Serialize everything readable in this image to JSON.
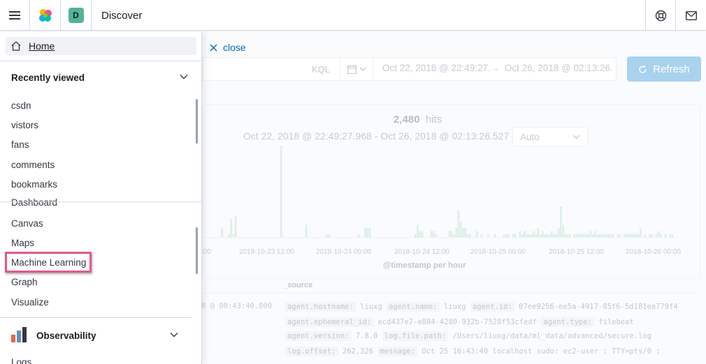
{
  "header": {
    "app_title": "Discover",
    "space_initial": "D",
    "icons": [
      "hamburger-menu-icon",
      "elastic-logo-icon",
      "help-icon",
      "mail-icon"
    ]
  },
  "nav": {
    "home_label": "Home",
    "recently_viewed_title": "Recently viewed",
    "recently_viewed": [
      "csdn",
      "vistors",
      "fans",
      "comments",
      "bookmarks"
    ],
    "kibana_links": [
      "Dashboard",
      "Canvas",
      "Maps",
      "Machine Learning",
      "Graph",
      "Visualize"
    ],
    "highlighted_item": "Machine Learning",
    "observability_title": "Observability",
    "observability_links": [
      "Logs"
    ]
  },
  "discover": {
    "close_label": "close",
    "query_language": "KQL",
    "date_from": "Oct 22, 2018 @ 22:49:27.",
    "date_to": "Oct 26, 2018 @ 02:13:26.",
    "refresh_label": "Refresh",
    "hits_count": "2,480",
    "hits_label": "hits",
    "range_text": "Oct 22, 2018 @ 22:49:27.968 - Oct 26, 2018 @ 02:13:26.527 —",
    "interval": "Auto",
    "x_ticks": [
      ":00",
      "2018-10-23 12:00",
      "2018-10-24 00:00",
      "2018-10-24 12:00",
      "2018-10-25 00:00",
      "2018-10-25 12:00",
      "2018-10-26 00:00"
    ],
    "x_axis_title": "@timestamp per hour",
    "source_header": "_source",
    "row_timestamp": "8 @ 00:43:40.000",
    "source_lines": [
      [
        [
          "agent.hostname:",
          "liuxg"
        ],
        [
          "agent.name:",
          "liuxg"
        ],
        [
          "agent.id:",
          "07ee9256-ee5a-4917-85f6-5d181ea779f4"
        ]
      ],
      [
        [
          "agent.ephemeral_id:",
          "ecd437e7-e884-4280-932b-7528f53cfedf"
        ],
        [
          "agent.type:",
          "filebeat"
        ]
      ],
      [
        [
          "agent.version:",
          "7.8.0"
        ],
        [
          "log.file.path:",
          "/Users/liuxg/data/ml_data/advanced/secure.log"
        ]
      ],
      [
        [
          "log.offset:",
          "262,326"
        ],
        [
          "message:",
          "Oct 25 16:43:40 localhost sudo: ec2-user : TTY=pts/0 ;"
        ]
      ]
    ]
  },
  "chart_data": {
    "type": "bar",
    "title": "",
    "xlabel": "@timestamp per hour",
    "ylabel": "",
    "values": [
      0,
      0,
      0,
      0,
      0,
      0,
      0,
      0,
      3,
      0,
      0,
      1,
      6,
      1,
      7,
      0,
      0,
      0,
      0,
      0,
      0,
      0,
      0,
      0,
      0,
      0,
      0,
      0,
      0,
      0,
      0,
      0,
      0,
      0,
      30,
      0,
      0,
      0,
      0,
      0,
      0,
      0,
      0,
      0,
      0,
      4,
      0,
      0,
      0,
      0,
      0,
      0,
      0,
      0,
      1,
      1,
      0,
      0,
      0,
      0,
      0,
      0,
      0,
      0,
      0,
      0,
      0,
      0,
      1,
      0,
      0,
      3,
      3,
      3,
      0,
      0,
      0,
      0,
      0,
      0,
      0,
      0,
      0,
      0,
      0,
      0,
      0,
      0,
      0,
      0,
      0,
      0,
      0,
      1,
      4,
      2,
      2,
      0,
      0,
      0,
      2,
      2,
      1,
      0,
      0,
      0,
      0,
      0,
      2,
      2,
      1,
      3,
      9,
      5,
      3,
      3,
      1,
      1,
      0,
      0,
      2,
      0,
      1,
      0,
      0,
      1,
      0,
      0,
      1,
      0,
      0,
      0,
      1,
      1,
      1,
      0,
      1,
      1,
      0,
      2,
      1,
      2,
      1,
      1,
      1,
      2,
      1,
      3,
      1,
      2,
      1,
      1,
      1,
      2,
      1,
      1,
      3,
      10,
      4,
      1,
      1,
      1,
      0,
      1,
      1,
      1,
      1,
      1,
      1,
      1,
      2,
      1,
      2,
      1,
      1,
      1,
      1,
      1,
      1,
      1,
      1,
      0,
      1,
      1,
      0,
      1,
      1,
      1,
      1,
      1,
      1,
      1,
      3,
      0,
      1,
      0,
      1,
      1,
      0,
      1,
      2,
      1,
      0,
      1,
      0,
      1,
      1,
      0,
      0
    ],
    "ylim": [
      0,
      32
    ]
  }
}
